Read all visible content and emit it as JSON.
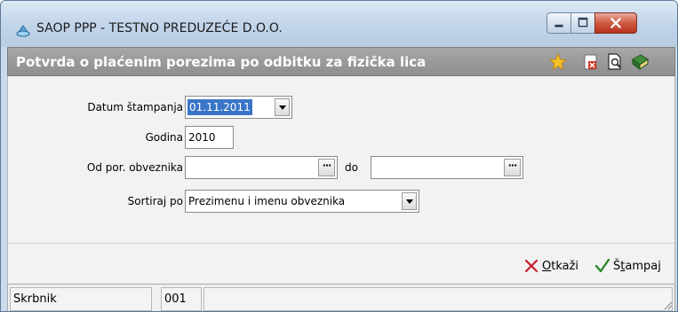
{
  "window": {
    "title": "SAOP PPP - TESTNO PREDUZEĆE D.O.O.",
    "controls": {
      "minimize": "minimize-icon",
      "maximize": "maximize-icon",
      "close": "close-icon"
    }
  },
  "header": {
    "title": "Potvrda o plaćenim porezima po odbitku za fizička lica",
    "tools": [
      "star-icon",
      "delete-document-icon",
      "print-preview-icon",
      "book-icon"
    ]
  },
  "form": {
    "datum_label": "Datum štampanja",
    "datum_value": "01.11.2011",
    "godina_label": "Godina",
    "godina_value": "2010",
    "od_label": "Od por. obveznika",
    "od_value": "",
    "do_label": "do",
    "do_value": "",
    "sort_label": "Sortiraj po",
    "sort_value": "Prezimenu i imenu obveznika",
    "dots": "···"
  },
  "actions": {
    "cancel_prefix": "",
    "cancel_accel": "O",
    "cancel_rest": "tkaži",
    "print_prefix": "Š",
    "print_accel": "t",
    "print_rest": "ampaj"
  },
  "status": {
    "cell1": "Skrbnik",
    "cell2": "001",
    "cell3": ""
  },
  "colors": {
    "header_bg": "#999999",
    "selection": "#3a76c8",
    "cancel_red": "#c8202a",
    "confirm_green": "#2a8a2a"
  }
}
